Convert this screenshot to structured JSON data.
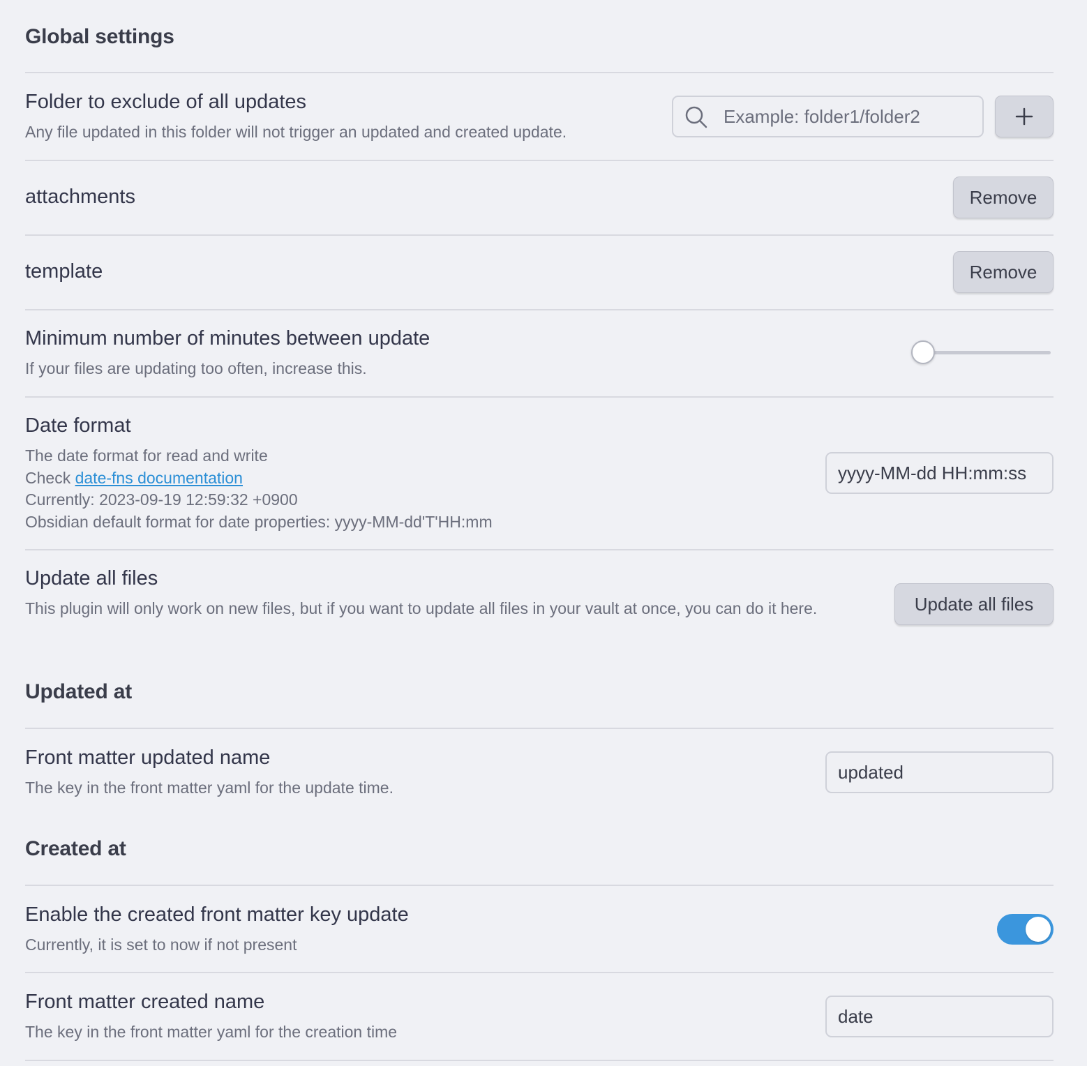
{
  "sections": {
    "global": "Global settings",
    "updated": "Updated at",
    "created": "Created at"
  },
  "exclude": {
    "name": "Folder to exclude of all updates",
    "desc": "Any file updated in this folder will not trigger an updated and created update.",
    "placeholder": "Example: folder1/folder2",
    "add_icon": "plus-icon",
    "search_icon": "search-icon",
    "folders": [
      {
        "name": "attachments",
        "button": "Remove"
      },
      {
        "name": "template",
        "button": "Remove"
      }
    ]
  },
  "min_minutes": {
    "name": "Minimum number of minutes between update",
    "desc": "If your files are updating too often, increase this.",
    "slider_value_fraction": 0
  },
  "date_format": {
    "name": "Date format",
    "desc_line1": "The date format for read and write",
    "check_prefix": "Check ",
    "link": "date-fns documentation",
    "currently": "Currently: 2023-09-19 12:59:32 +0900",
    "obsidian_default": "Obsidian default format for date properties: yyyy-MM-dd'T'HH:mm",
    "value": "yyyy-MM-dd HH:mm:ss"
  },
  "update_all": {
    "name": "Update all files",
    "desc": "This plugin will only work on new files, but if you want to update all files in your vault at once, you can do it here.",
    "button": "Update all files"
  },
  "updated_name": {
    "name": "Front matter updated name",
    "desc": "The key in the front matter yaml for the update time.",
    "value": "updated"
  },
  "enable_created": {
    "name": "Enable the created front matter key update",
    "desc": "Currently, it is set to now if not present",
    "enabled": true
  },
  "created_name": {
    "name": "Front matter created name",
    "desc": "The key in the front matter yaml for the creation time",
    "value": "date"
  },
  "colors": {
    "background": "#f0f1f5",
    "accent": "#3b96dd",
    "link": "#2b8fd6",
    "button": "#d6d8e0"
  }
}
